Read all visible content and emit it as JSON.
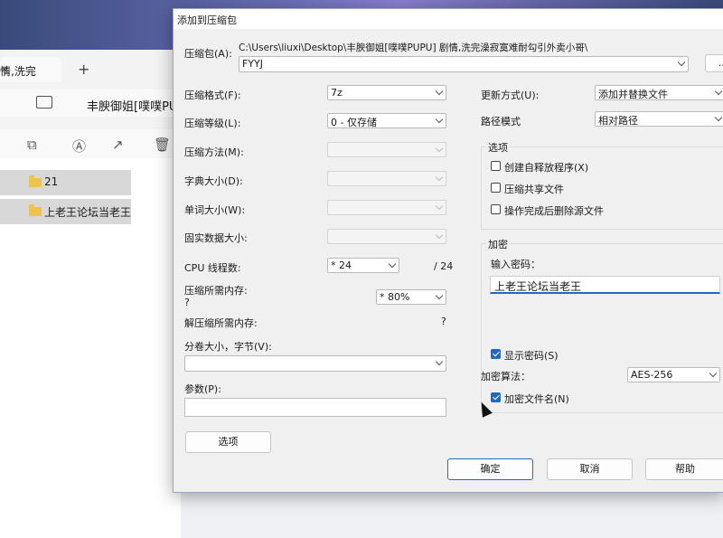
{
  "explorer": {
    "tab_label": "情,洗完",
    "tab_close": "✕",
    "tab_add": "+",
    "path": "丰腴御姐[噗噗PU",
    "items": [
      {
        "name": "21"
      },
      {
        "name": "上老王论坛当老王"
      }
    ]
  },
  "dialog": {
    "title": "添加到压缩包",
    "archive": {
      "label": "压缩包(A):",
      "dir": "C:\\Users\\liuxi\\Desktop\\丰腴御姐[噗噗PUPU] 剧情,洗完澡寂寞难耐勾引外卖小哥\\",
      "name": "FYYJ",
      "browse": "..."
    },
    "left": {
      "format": {
        "label": "压缩格式(F):",
        "value": "7z"
      },
      "level": {
        "label": "压缩等级(L):",
        "value": "0 - 仅存储"
      },
      "method": {
        "label": "压缩方法(M):"
      },
      "dict": {
        "label": "字典大小(D):"
      },
      "word": {
        "label": "单词大小(W):"
      },
      "solid": {
        "label": "固实数据大小:"
      },
      "cpu": {
        "label": "CPU 线程数:",
        "value": "* 24",
        "total": "/ 24"
      },
      "mem_comp": {
        "label": "压缩所需内存:",
        "q": "?",
        "value": "* 80%"
      },
      "mem_decomp": {
        "label": "解压缩所需内存:",
        "value": "?"
      },
      "volume": {
        "label": "分卷大小，字节(V):"
      },
      "params": {
        "label": "参数(P):"
      },
      "options_button": "选项"
    },
    "right": {
      "update": {
        "label": "更新方式(U):",
        "value": "添加并替换文件"
      },
      "pathmode": {
        "label": "路径模式",
        "value": "相对路径"
      },
      "options": {
        "title": "选项",
        "sfx": "创建自释放程序(X)",
        "shared": "压缩共享文件",
        "delete": "操作完成后删除源文件"
      },
      "encryption": {
        "title": "加密",
        "enter_label": "输入密码：",
        "password": "上老王论坛当老王",
        "show_password": "显示密码(S)",
        "method_label": "加密算法：",
        "method_value": "AES-256",
        "encrypt_names": "加密文件名(N)"
      }
    },
    "buttons": {
      "ok": "确定",
      "cancel": "取消",
      "help": "帮助"
    }
  }
}
